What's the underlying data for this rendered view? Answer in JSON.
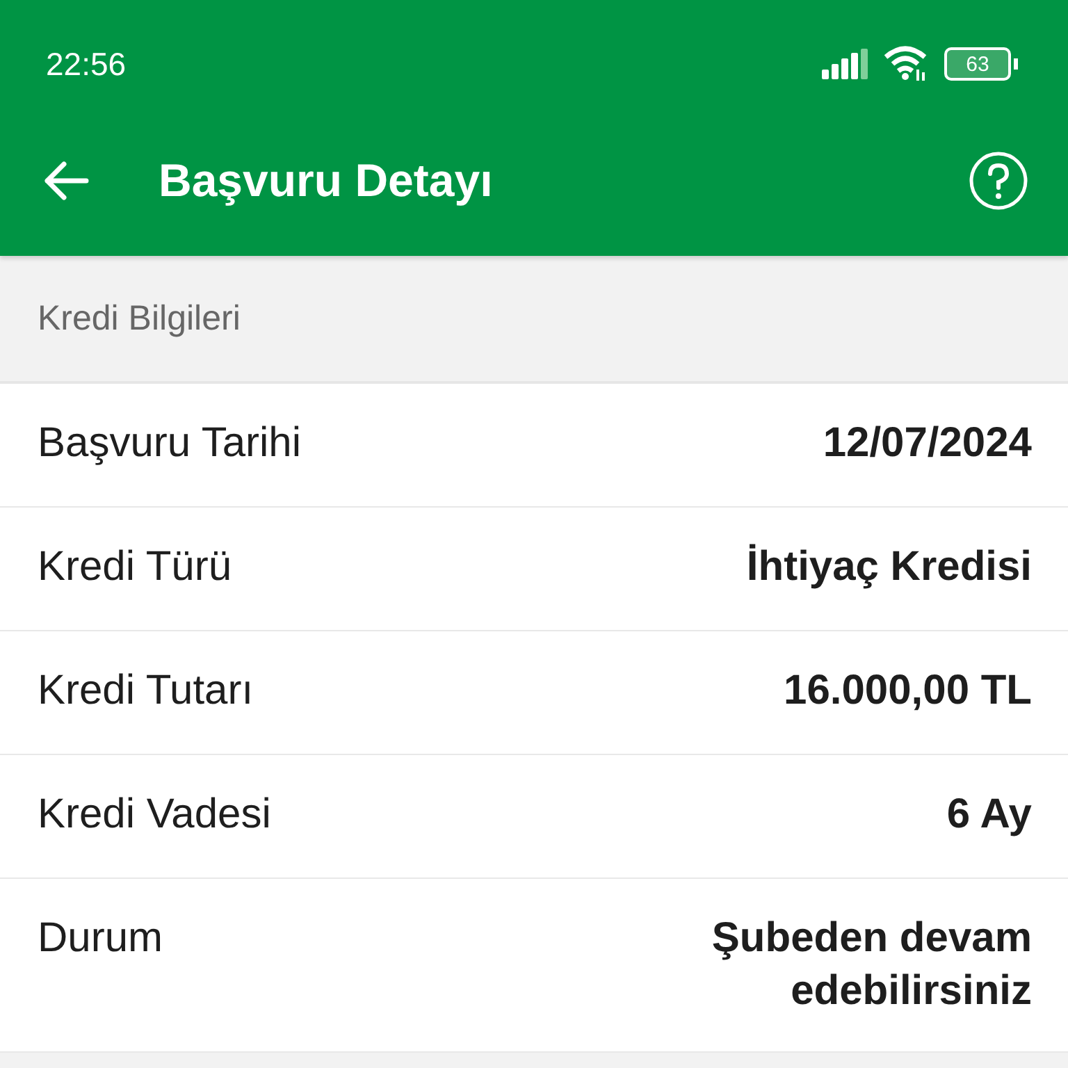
{
  "status_bar": {
    "time": "22:56",
    "battery": "63"
  },
  "app_bar": {
    "title": "Başvuru Detayı"
  },
  "section": {
    "title": "Kredi Bilgileri"
  },
  "rows": [
    {
      "label": "Başvuru Tarihi",
      "value": "12/07/2024"
    },
    {
      "label": "Kredi Türü",
      "value": "İhtiyaç Kredisi"
    },
    {
      "label": "Kredi Tutarı",
      "value": "16.000,00 TL"
    },
    {
      "label": "Kredi Vadesi",
      "value": "6 Ay"
    },
    {
      "label": "Durum",
      "value": "Şubeden devam edebilirsiniz"
    }
  ]
}
